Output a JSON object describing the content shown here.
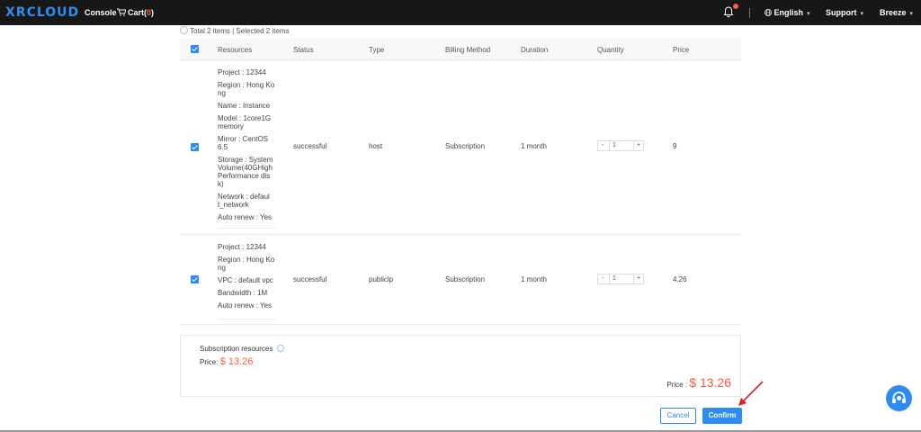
{
  "header": {
    "brand": "XRCLOUD",
    "console_label": "Console",
    "cart_label": "Cart(",
    "cart_count": "0",
    "cart_close": ")",
    "language": "English",
    "support": "Support",
    "user": "Breeze"
  },
  "summary": "Total 2 items | Selected 2 items",
  "table": {
    "columns": [
      "Resources",
      "Status",
      "Type",
      "Billing Method",
      "Duration",
      "Quantity",
      "Price"
    ],
    "rows": [
      {
        "resources": [
          "Project : 12344",
          "Region : Hong Ko ng",
          "Name : Instance",
          "Model : 1core1G memory",
          "Mirror : CentOS 6.5",
          "Storage : System Volume(40GHigh Performance dis k)",
          "Network : defaul t_network",
          "Auto renew : Yes"
        ],
        "status": "successful",
        "type": "host",
        "billing": "Subscription",
        "duration": "1 month",
        "quantity": "1",
        "price": "9"
      },
      {
        "resources": [
          "Project : 12344",
          "Region : Hong Ko ng",
          "VPC : default vpc",
          "Bandwidth : 1M",
          "Auto renew : Yes"
        ],
        "status": "successful",
        "type": "publiclp",
        "billing": "Subscription",
        "duration": "1 month",
        "quantity": "1",
        "price": "4.26"
      }
    ],
    "stepper_minus": "-",
    "stepper_plus": "+"
  },
  "subscription": {
    "title": "Subscription resources",
    "price_label": "Price:",
    "price_value": "$ 13.26"
  },
  "total": {
    "label": "Price :",
    "value": "$ 13.26"
  },
  "buttons": {
    "cancel": "Cancel",
    "confirm": "Confirm"
  },
  "colors": {
    "accent": "#2d8cf0",
    "price": "#ff5a3c",
    "topbar": "#171717"
  }
}
